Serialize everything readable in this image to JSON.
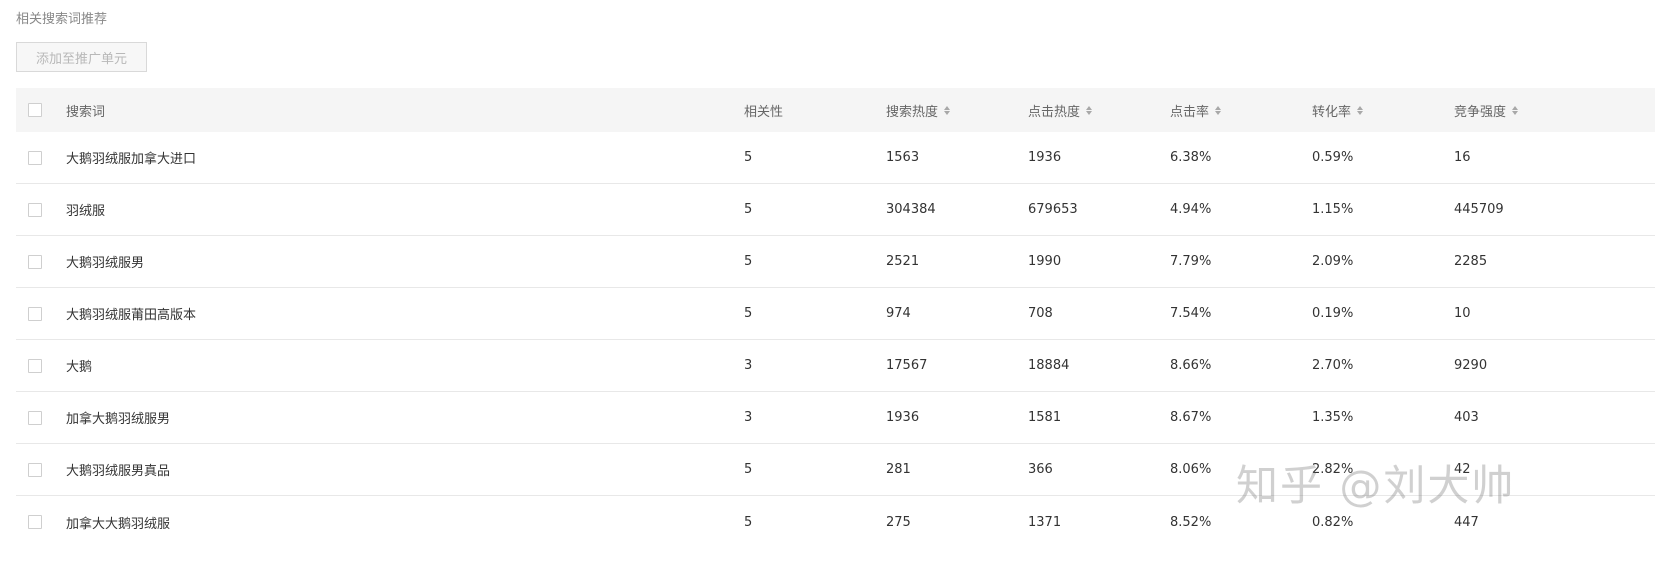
{
  "section_title": "相关搜索词推荐",
  "add_button": "添加至推广单元",
  "columns": {
    "keyword": "搜索词",
    "relevance": "相关性",
    "search_heat": "搜索热度",
    "click_heat": "点击热度",
    "ctr": "点击率",
    "cvr": "转化率",
    "competition": "竞争强度"
  },
  "rows": [
    {
      "keyword": "大鹅羽绒服加拿大进口",
      "relevance": "5",
      "search_heat": "1563",
      "click_heat": "1936",
      "ctr": "6.38%",
      "cvr": "0.59%",
      "competition": "16"
    },
    {
      "keyword": "羽绒服",
      "relevance": "5",
      "search_heat": "304384",
      "click_heat": "679653",
      "ctr": "4.94%",
      "cvr": "1.15%",
      "competition": "445709"
    },
    {
      "keyword": "大鹅羽绒服男",
      "relevance": "5",
      "search_heat": "2521",
      "click_heat": "1990",
      "ctr": "7.79%",
      "cvr": "2.09%",
      "competition": "2285"
    },
    {
      "keyword": "大鹅羽绒服莆田高版本",
      "relevance": "5",
      "search_heat": "974",
      "click_heat": "708",
      "ctr": "7.54%",
      "cvr": "0.19%",
      "competition": "10"
    },
    {
      "keyword": "大鹅",
      "relevance": "3",
      "search_heat": "17567",
      "click_heat": "18884",
      "ctr": "8.66%",
      "cvr": "2.70%",
      "competition": "9290"
    },
    {
      "keyword": "加拿大鹅羽绒服男",
      "relevance": "3",
      "search_heat": "1936",
      "click_heat": "1581",
      "ctr": "8.67%",
      "cvr": "1.35%",
      "competition": "403"
    },
    {
      "keyword": "大鹅羽绒服男真品",
      "relevance": "5",
      "search_heat": "281",
      "click_heat": "366",
      "ctr": "8.06%",
      "cvr": "2.82%",
      "competition": "42"
    },
    {
      "keyword": "加拿大大鹅羽绒服",
      "relevance": "5",
      "search_heat": "275",
      "click_heat": "1371",
      "ctr": "8.52%",
      "cvr": "0.82%",
      "competition": "447"
    }
  ],
  "watermark": "知乎 @刘大帅"
}
